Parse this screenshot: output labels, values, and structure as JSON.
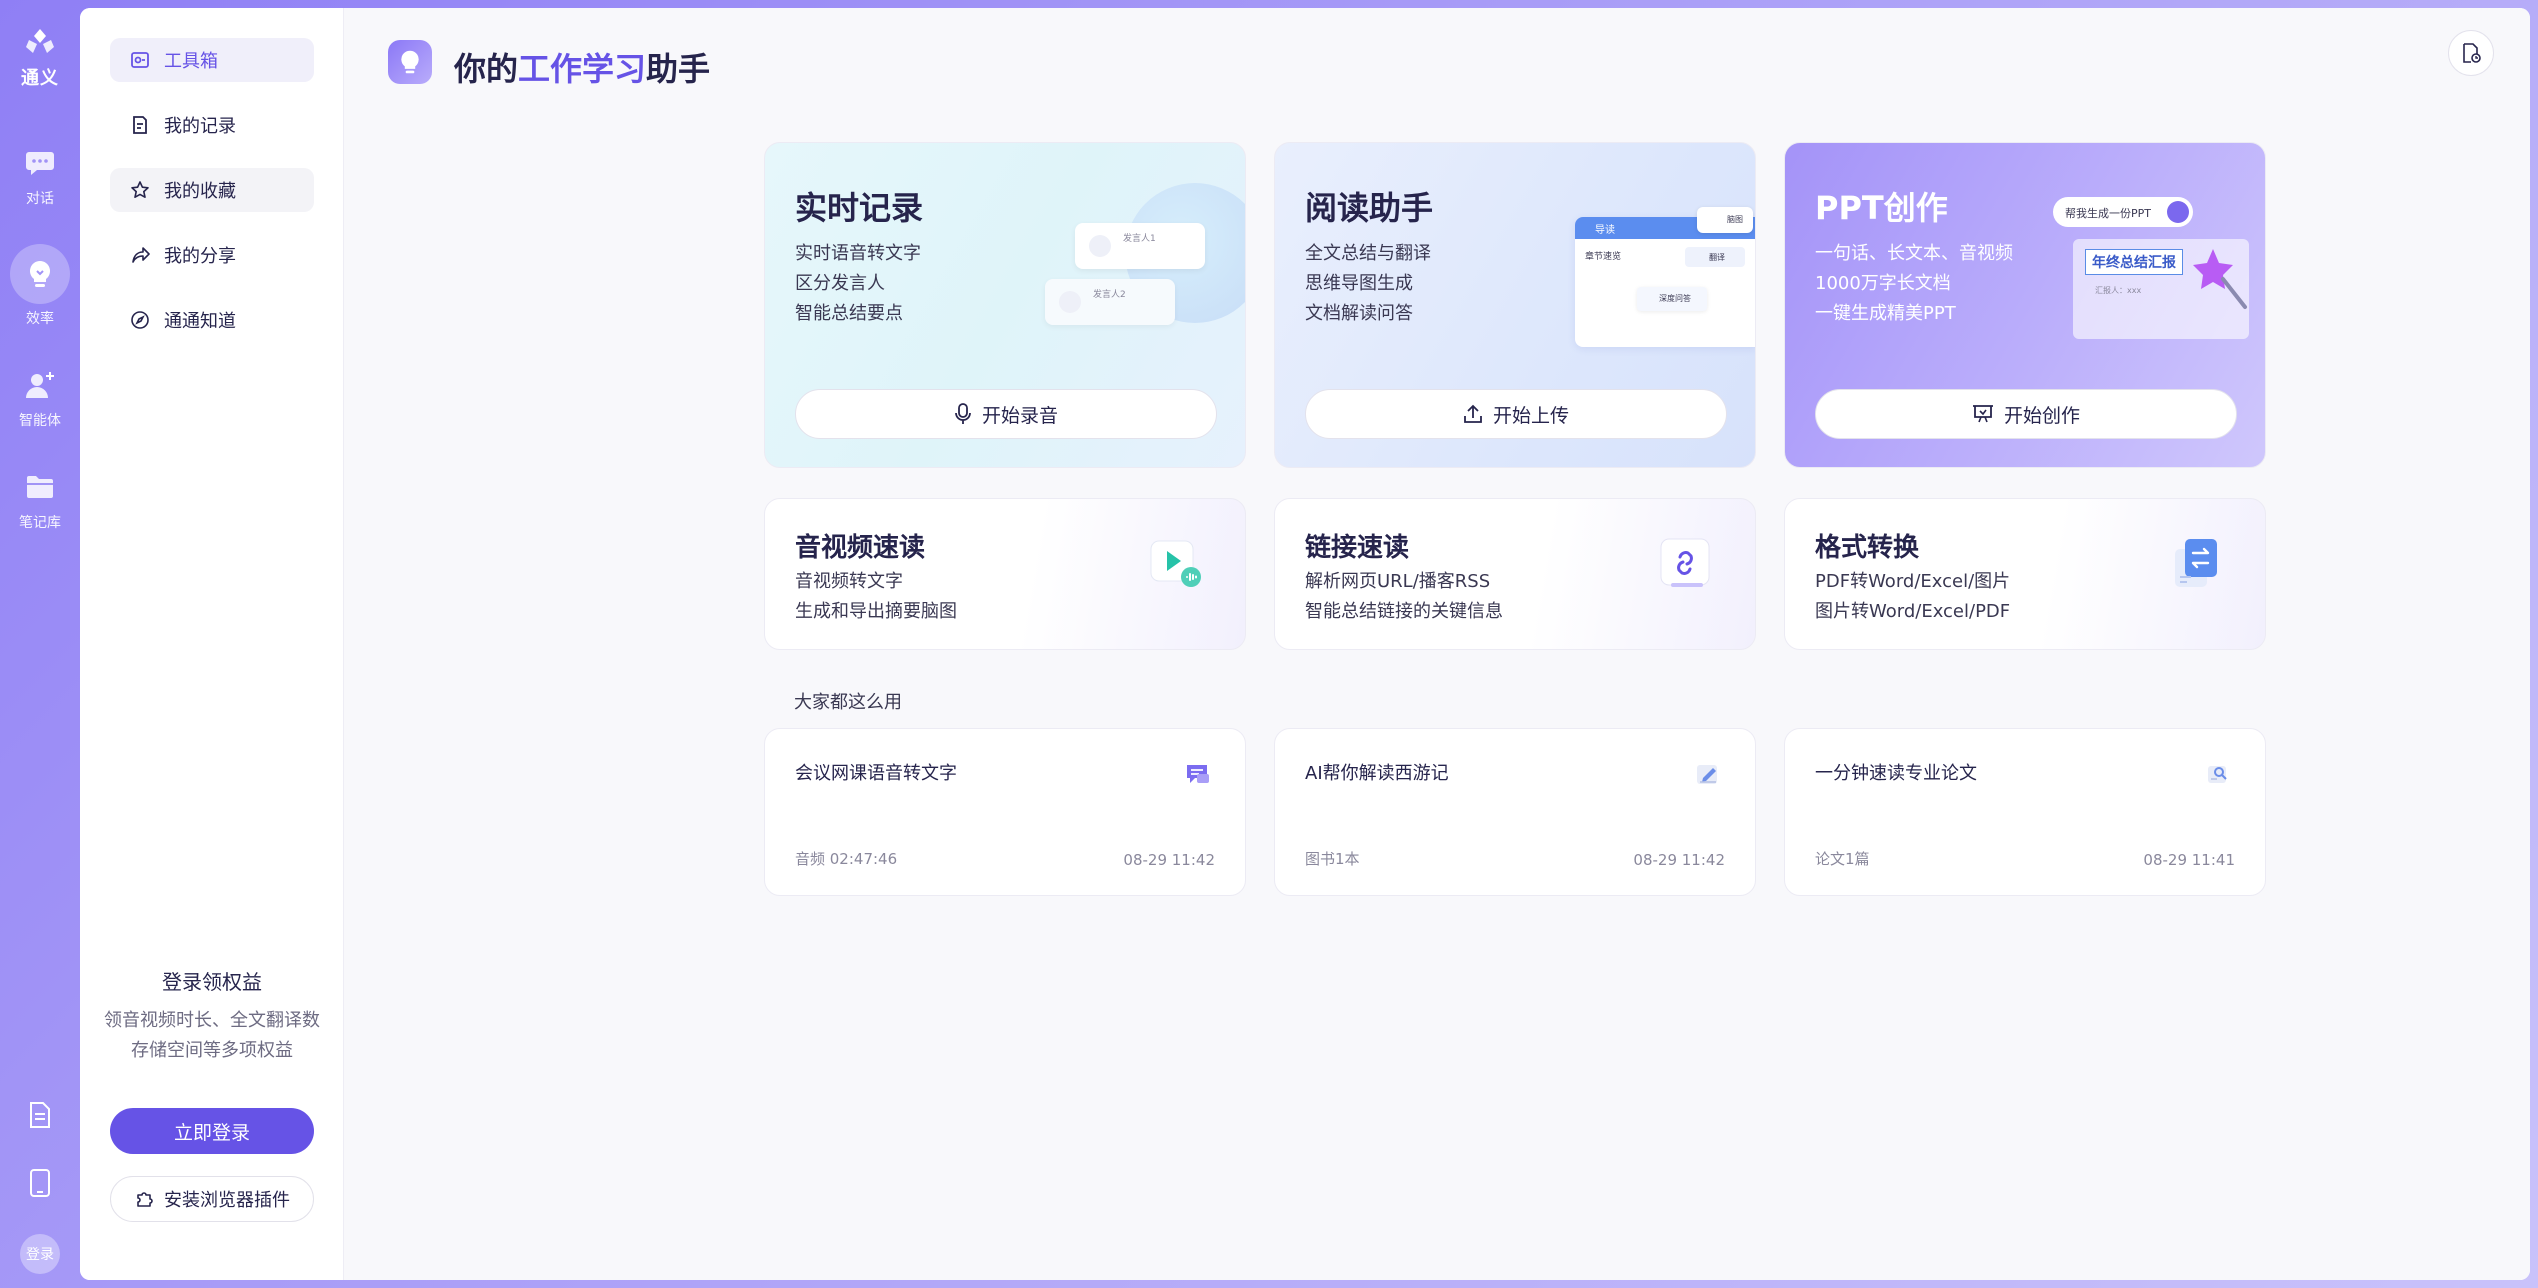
{
  "app": {
    "name": "通义",
    "accent": "#6653e6"
  },
  "rail": {
    "items": [
      {
        "label": "对话",
        "icon": "chat-bubble-icon"
      },
      {
        "label": "效率",
        "icon": "lightbulb-icon"
      },
      {
        "label": "智能体",
        "icon": "agent-add-icon"
      },
      {
        "label": "笔记库",
        "icon": "folder-icon"
      }
    ],
    "bottom": {
      "doc_icon": "document-icon",
      "tablet_icon": "tablet-icon",
      "avatar_label": "登录"
    }
  },
  "sidebar": {
    "items": [
      {
        "label": "工具箱",
        "icon": "toolbox-icon"
      },
      {
        "label": "我的记录",
        "icon": "record-icon"
      },
      {
        "label": "我的收藏",
        "icon": "star-icon"
      },
      {
        "label": "我的分享",
        "icon": "share-icon"
      },
      {
        "label": "通通知道",
        "icon": "compass-icon"
      }
    ],
    "promo_title": "登录领权益",
    "promo_desc": "领音视频时长、全文翻译数存储空间等多项权益",
    "login_button": "立即登录",
    "plugin_button": "安装浏览器插件"
  },
  "header": {
    "title_prefix": "你的",
    "title_highlight": "工作学习",
    "title_suffix": "助手"
  },
  "big_cards": [
    {
      "title": "实时记录",
      "lines": [
        "实时语音转文字",
        "区分发言人",
        "智能总结要点"
      ],
      "button": "开始录音",
      "illus": {
        "speaker1": "发言人1",
        "speaker2": "发言人2"
      }
    },
    {
      "title": "阅读助手",
      "lines": [
        "全文总结与翻译",
        "思维导图生成",
        "文档解读问答"
      ],
      "button": "开始上传",
      "illus": {
        "guide": "导读",
        "mindmap": "脑图",
        "chapter": "章节速览",
        "translate": "翻译",
        "qa": "深度问答"
      }
    },
    {
      "title": "PPT创作",
      "lines": [
        "一句话、长文本、音视频",
        "1000万字长文档",
        "一键生成精美PPT"
      ],
      "button": "开始创作",
      "illus": {
        "prompt": "帮我生成一份PPT",
        "slide_title": "年终总结汇报",
        "reporter": "汇报人：xxx"
      }
    }
  ],
  "mid_cards": [
    {
      "title": "音视频速读",
      "lines": [
        "音视频转文字",
        "生成和导出摘要脑图"
      ],
      "icon": "video-play-icon"
    },
    {
      "title": "链接速读",
      "lines": [
        "解析网页URL/播客RSS",
        "智能总结链接的关键信息"
      ],
      "icon": "link-icon"
    },
    {
      "title": "格式转换",
      "lines": [
        "PDF转Word/Excel/图片",
        "图片转Word/Excel/PDF"
      ],
      "icon": "convert-icon"
    }
  ],
  "section_label": "大家都这么用",
  "rec_cards": [
    {
      "title": "会议网课语音转文字",
      "meta": "音频 02:47:46",
      "time": "08-29 11:42",
      "icon": "chat-text-icon"
    },
    {
      "title": "AI帮你解读西游记",
      "meta": "图书1本",
      "time": "08-29 11:42",
      "icon": "pen-edit-icon"
    },
    {
      "title": "一分钟速读专业论文",
      "meta": "论文1篇",
      "time": "08-29 11:41",
      "icon": "paper-search-icon"
    }
  ]
}
